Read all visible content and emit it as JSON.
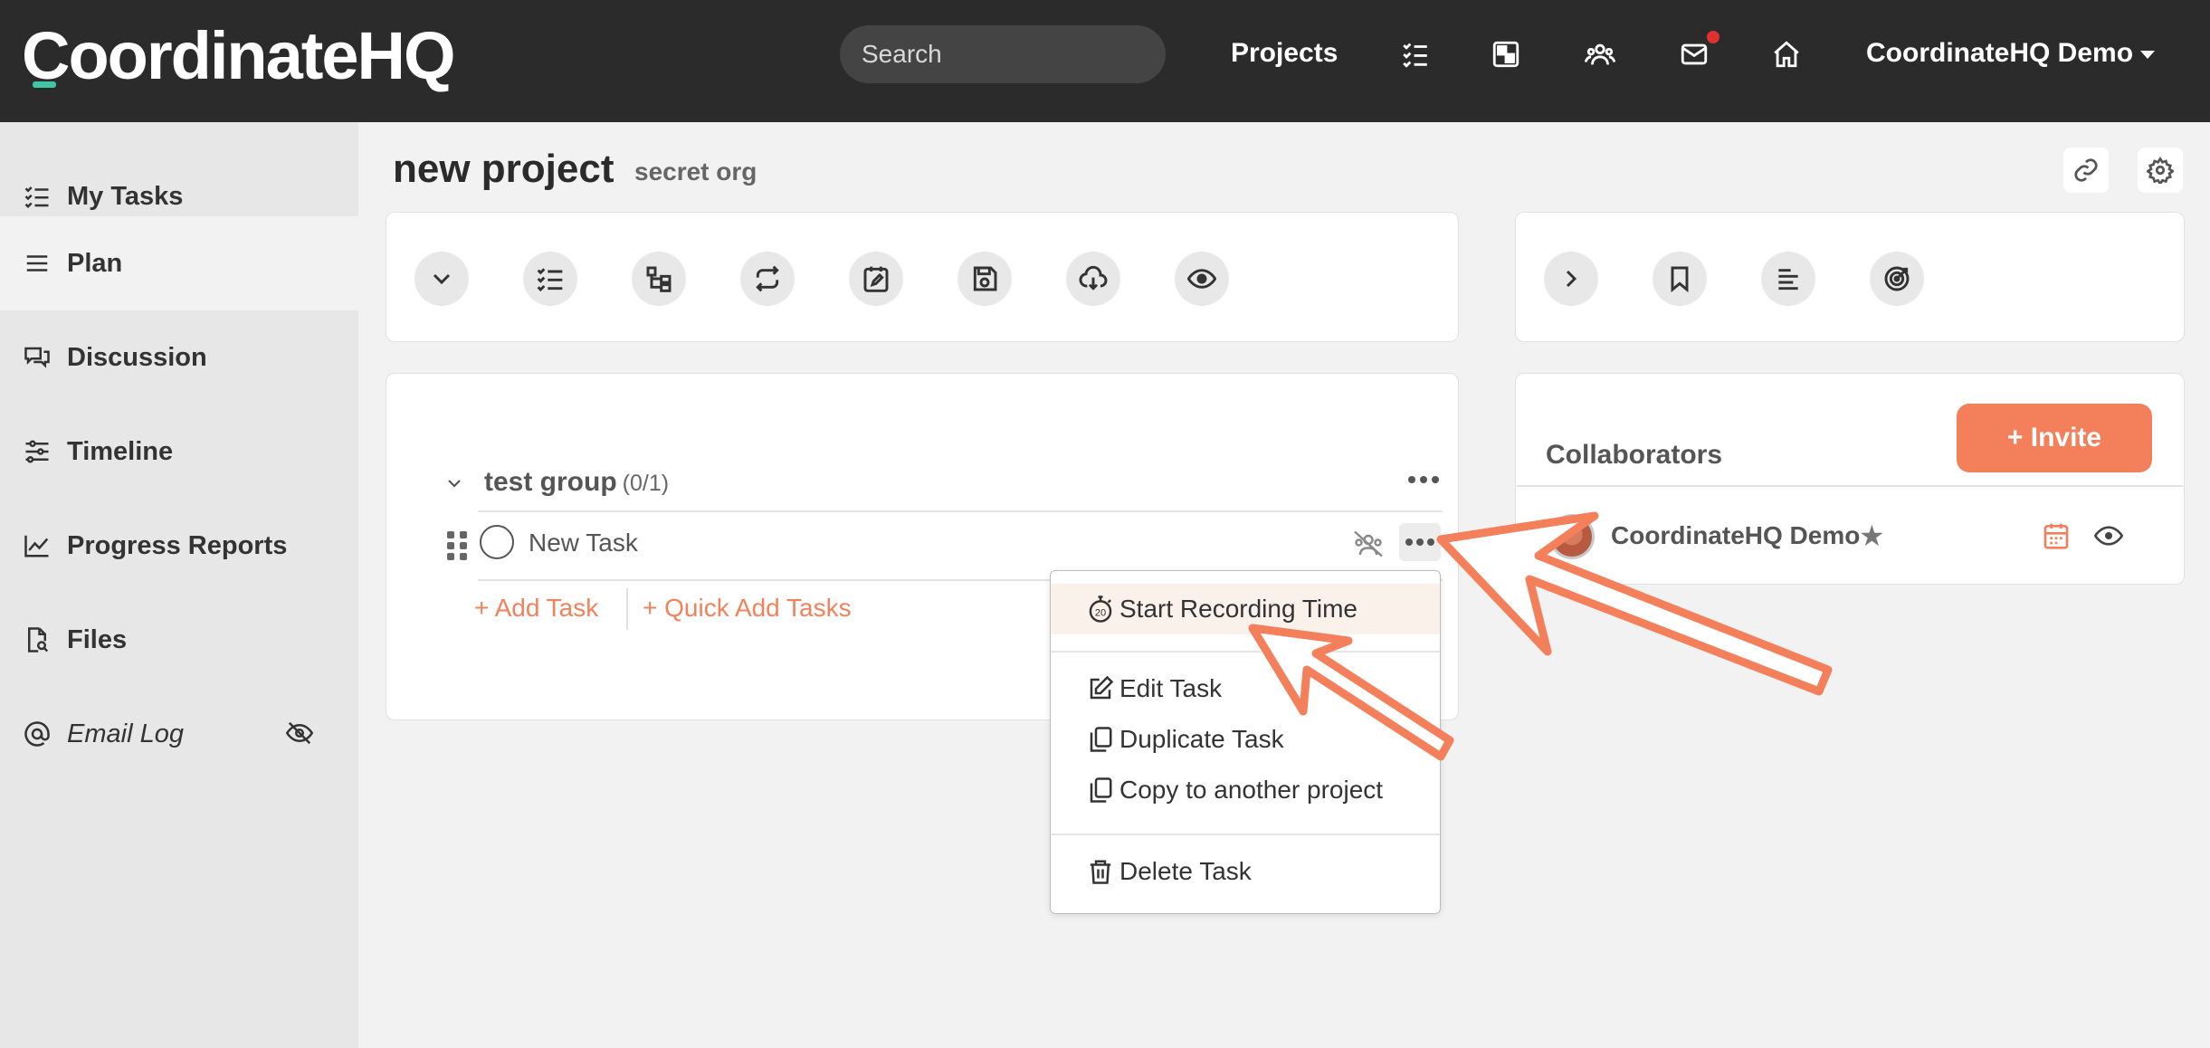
{
  "topnav": {
    "logo": "CoordinateHQ",
    "search_placeholder": "Search",
    "projects_label": "Projects",
    "icons": [
      "tasks-icon",
      "board-icon",
      "people-icon",
      "mail-icon",
      "home-icon"
    ],
    "user_label": "CoordinateHQ Demo"
  },
  "sidebar": {
    "items": [
      {
        "label": "My Tasks",
        "icon": "list-check-icon"
      },
      {
        "label": "Plan",
        "icon": "list-icon",
        "active": true
      },
      {
        "label": "Discussion",
        "icon": "chat-icon"
      },
      {
        "label": "Timeline",
        "icon": "sliders-icon"
      },
      {
        "label": "Progress Reports",
        "icon": "chart-icon"
      },
      {
        "label": "Files",
        "icon": "file-search-icon"
      },
      {
        "label": "Email Log",
        "icon": "at-icon",
        "hidden_icon": "eye-off-icon"
      }
    ]
  },
  "page": {
    "title": "new project",
    "subtitle": "secret org"
  },
  "toolbar_left": [
    "chevron-down-icon",
    "list-check-icon",
    "hierarchy-icon",
    "repeat-icon",
    "calendar-edit-icon",
    "save-icon",
    "cloud-download-icon",
    "eye-icon"
  ],
  "toolbar_right": [
    "chevron-right-icon",
    "bookmark-icon",
    "align-left-icon",
    "target-icon"
  ],
  "group": {
    "name": "test group",
    "count": "(0/1)",
    "task": "New Task",
    "add_task": "+ Add Task",
    "quick_add": "+ Quick Add Tasks"
  },
  "task_menu": {
    "start_recording": "Start Recording Time",
    "edit": "Edit Task",
    "duplicate": "Duplicate Task",
    "copy": "Copy to another project",
    "delete": "Delete Task"
  },
  "collaborators": {
    "title": "Collaborators",
    "invite": "+ Invite",
    "members": [
      {
        "name": "CoordinateHQ Demo"
      }
    ]
  },
  "colors": {
    "accent": "#f47f5b",
    "nav_bg": "#2b2b2b",
    "logo_accent": "#3fc6a8"
  }
}
